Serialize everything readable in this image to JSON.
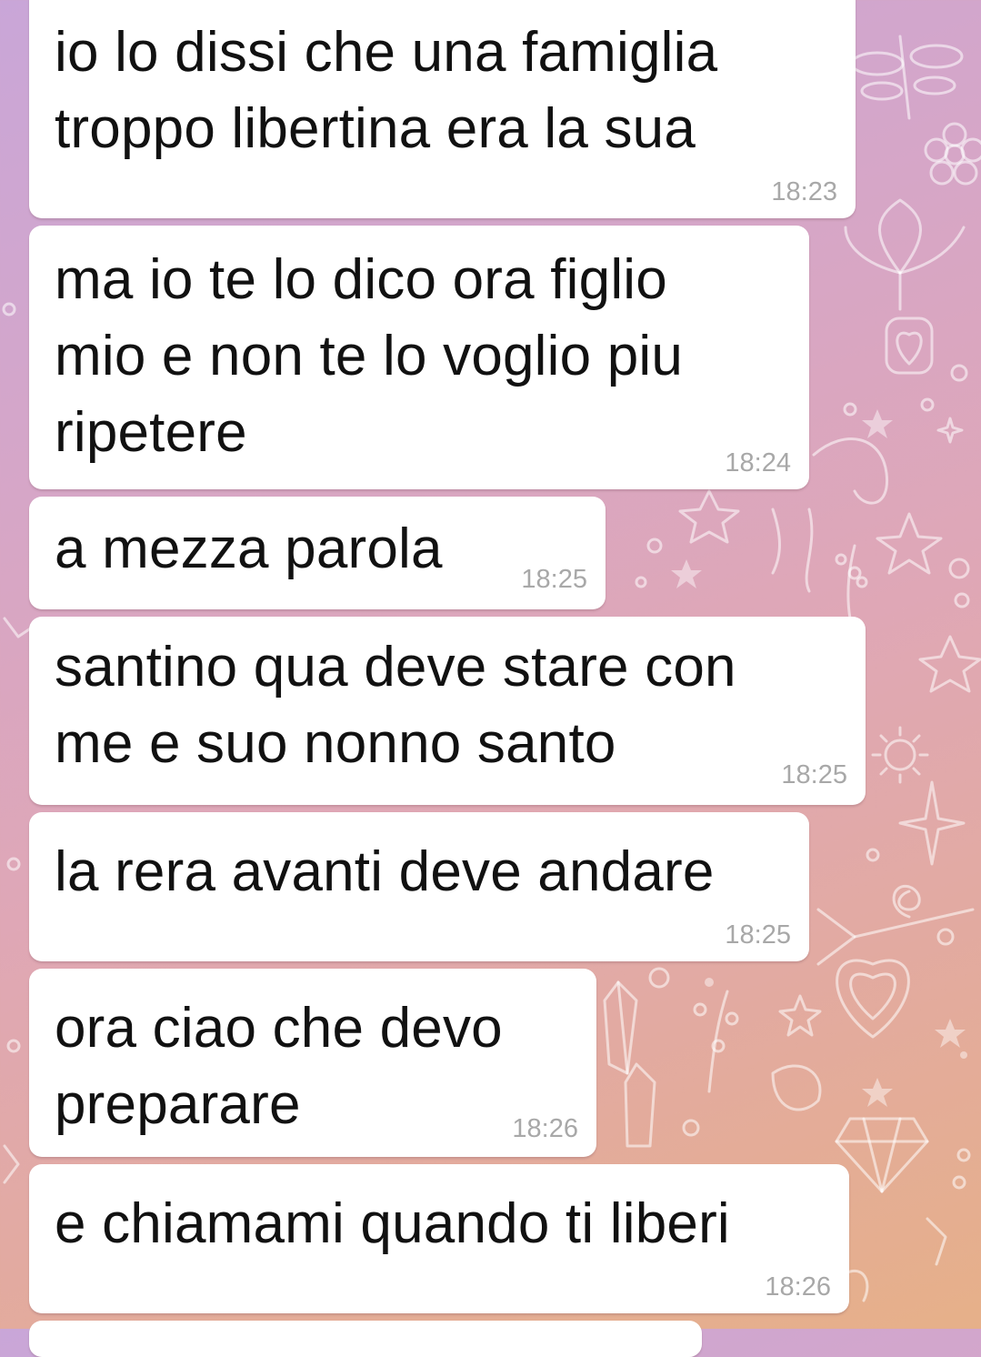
{
  "theme": {
    "bubble_color": "#ffffff",
    "text_color": "#111111",
    "time_color": "#a8a8a8",
    "wallpaper_colors": [
      "#c9a6d8",
      "#dfa7b6",
      "#e6b089"
    ]
  },
  "wallpaper_icons": [
    "dragonfly-icon",
    "flower-icon",
    "leaf-icon",
    "heart-icon",
    "star-icon",
    "unicorn-icon",
    "sun-icon",
    "diamond-icon",
    "crystal-icon",
    "branch-icon"
  ],
  "messages": [
    {
      "text": "io lo dissi che una famiglia\ntroppo libertina era la sua",
      "time": "18:23"
    },
    {
      "text": "ma io te lo dico ora figlio\nmio e non te lo voglio piu\nripetere",
      "time": "18:24"
    },
    {
      "text": "a mezza parola",
      "time": "18:25"
    },
    {
      "text": "santino qua deve stare con\nme e suo nonno santo",
      "time": "18:25"
    },
    {
      "text": "la rera avanti deve andare",
      "time": "18:25"
    },
    {
      "text": "ora ciao che devo\npreparare",
      "time": "18:26"
    },
    {
      "text": "e chiamami quando ti liberi",
      "time": "18:26"
    }
  ]
}
